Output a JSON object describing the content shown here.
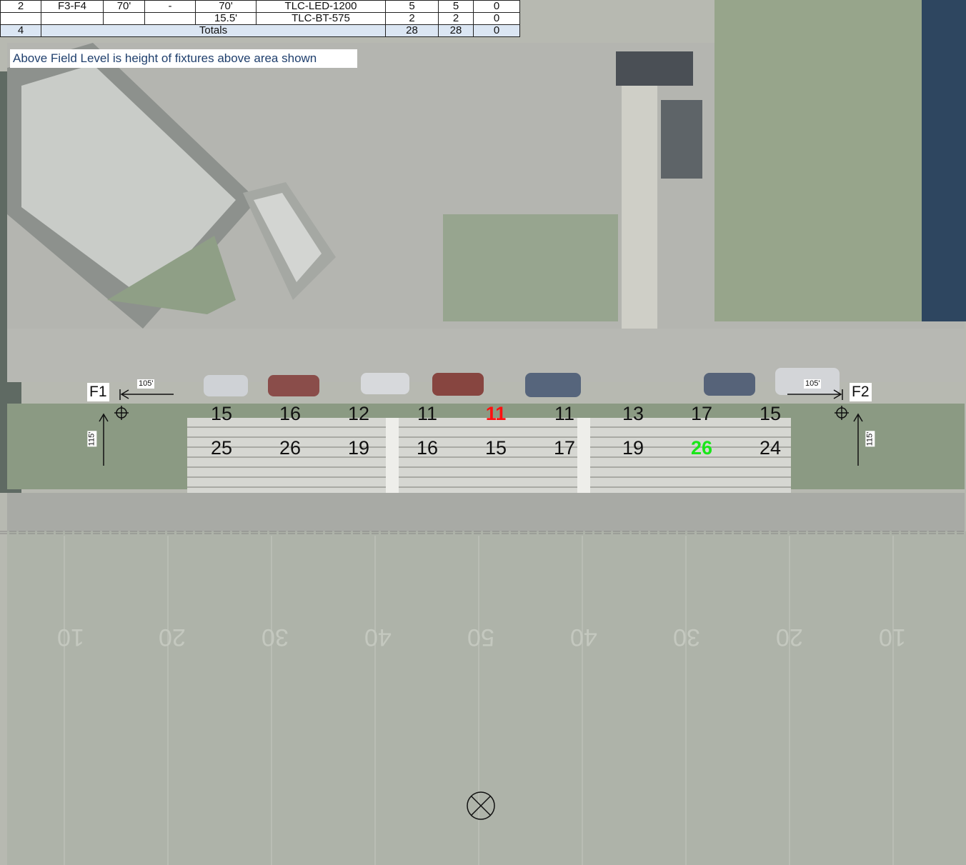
{
  "table": {
    "rows": [
      [
        "2",
        "F3-F4",
        "70'",
        "-",
        "70'",
        "TLC-LED-1200",
        "5",
        "5",
        "0"
      ],
      [
        "",
        "",
        "",
        "",
        "15.5'",
        "TLC-BT-575",
        "2",
        "2",
        "0"
      ]
    ],
    "totals": {
      "qty": "4",
      "label": "Totals",
      "c1": "28",
      "c2": "28",
      "c3": "0"
    }
  },
  "note": "Above Field Level is height of fixtures above area shown",
  "poles": {
    "left": {
      "name": "F1",
      "dim_h": "105'",
      "dim_v": "115'"
    },
    "right": {
      "name": "F2",
      "dim_h": "105'",
      "dim_v": "115'"
    }
  },
  "grid": {
    "row1": [
      "15",
      "16",
      "12",
      "11",
      "11",
      "11",
      "13",
      "17",
      "15"
    ],
    "row2": [
      "25",
      "26",
      "19",
      "16",
      "15",
      "17",
      "19",
      "26",
      "24"
    ],
    "min_color": "#ff1010",
    "max_color": "#19e619"
  },
  "field_numbers": [
    "10",
    "20",
    "30",
    "40",
    "50",
    "40",
    "30",
    "20",
    "10"
  ]
}
